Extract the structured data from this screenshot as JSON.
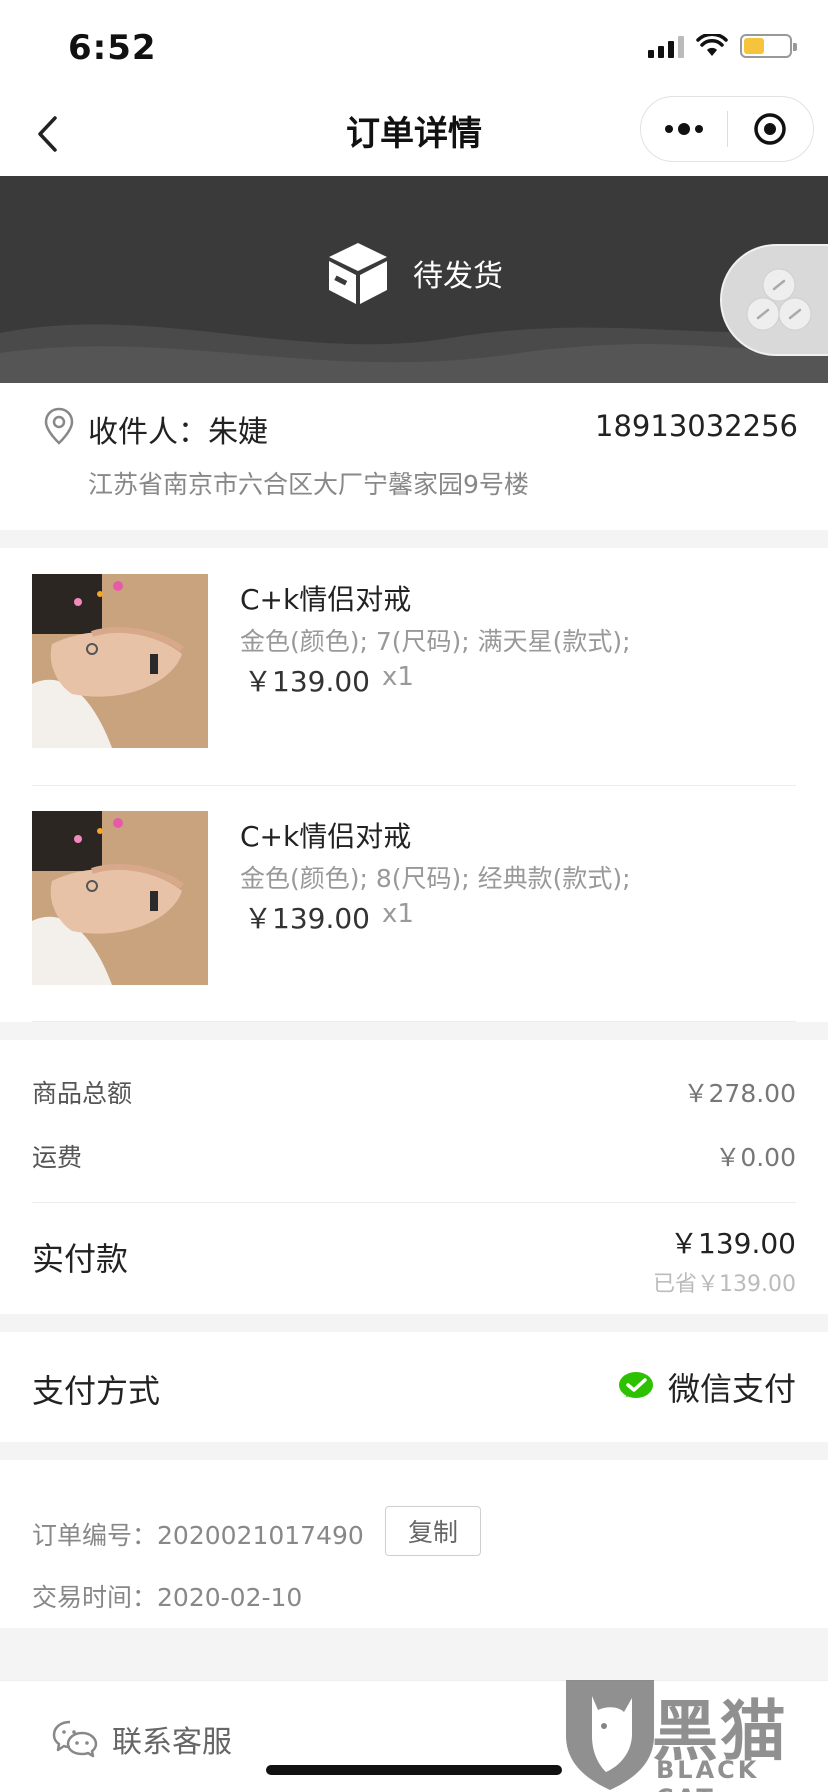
{
  "status_bar": {
    "time": "6:52"
  },
  "nav": {
    "title": "订单详情"
  },
  "banner": {
    "status": "待发货"
  },
  "address": {
    "recipient_label": "收件人：",
    "recipient_name": "朱婕",
    "phone": "18913032256",
    "address": "江苏省南京市六合区大厂宁馨家园9号楼"
  },
  "products": [
    {
      "name": "C+k情侣对戒",
      "spec": "金色(颜色); 7(尺码); 满天星(款式);",
      "price": "￥139.00",
      "qty": "x1"
    },
    {
      "name": "C+k情侣对戒",
      "spec": "金色(颜色); 8(尺码); 经典款(款式);",
      "price": "￥139.00",
      "qty": "x1"
    }
  ],
  "totals": {
    "goods_label": "商品总额",
    "goods_value": "￥278.00",
    "shipping_label": "运费",
    "shipping_value": "￥0.00",
    "paid_label": "实付款",
    "paid_value": "￥139.00",
    "saved_value": "已省￥139.00"
  },
  "payment": {
    "label": "支付方式",
    "method": "微信支付",
    "method_color": "#2dc100"
  },
  "order": {
    "number_label": "订单编号：",
    "number": "2020021017490",
    "copy_label": "复制",
    "time_label": "交易时间：",
    "time": "2020-02-10"
  },
  "service": {
    "label": "联系客服"
  },
  "watermark": {
    "cn": "黑猫",
    "en": "BLACK CAT"
  },
  "icons": {
    "back": "chevron-left-icon",
    "more": "more-dots-icon",
    "close": "target-circle-icon",
    "package": "box-icon",
    "share": "link-share-icon",
    "location": "location-pin-icon",
    "wechat_pay": "wechat-pay-icon",
    "service": "chat-bubbles-icon"
  }
}
